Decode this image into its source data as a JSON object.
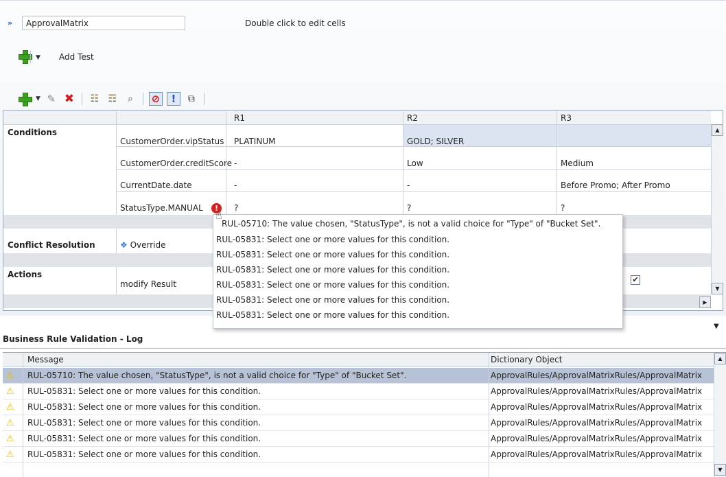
{
  "ruleset": {
    "name_value": "ApprovalMatrix",
    "hint": "Double click to edit cells",
    "add_test_label": "Add Test"
  },
  "grid": {
    "columns": [
      "R1",
      "R2",
      "R3"
    ],
    "sections": {
      "conditions": "Conditions",
      "conflict": "Conflict Resolution",
      "actions": "Actions"
    },
    "conditions": [
      {
        "name": "CustomerOrder.vipStatus",
        "values": [
          "PLATINUM",
          "GOLD; SILVER",
          ""
        ]
      },
      {
        "name": "CustomerOrder.creditScore",
        "values": [
          "-",
          "Low",
          "Medium"
        ]
      },
      {
        "name": "CurrentDate.date",
        "values": [
          "-",
          "-",
          "Before Promo; After Promo"
        ]
      },
      {
        "name": "StatusType.MANUAL",
        "values": [
          "?",
          "?",
          "?"
        ]
      }
    ],
    "conflict_value": "Override",
    "action_name": "modify Result",
    "action_checkbox_checked": true
  },
  "popup": {
    "messages": [
      "RUL-05710: The value chosen, \"StatusType\", is not a valid choice for \"Type\" of \"Bucket Set\".",
      "RUL-05831: Select one or more values for this condition.",
      "RUL-05831: Select one or more values for this condition.",
      "RUL-05831: Select one or more values for this condition.",
      "RUL-05831: Select one or more values for this condition.",
      "RUL-05831: Select one or more values for this condition.",
      "RUL-05831: Select one or more values for this condition."
    ]
  },
  "log": {
    "tab_title": "Business Rule Validation - Log",
    "headers": {
      "message": "Message",
      "object": "Dictionary Object"
    },
    "rows": [
      {
        "message": "RUL-05710: The value chosen, \"StatusType\", is not a valid choice for \"Type\" of \"Bucket Set\".",
        "object": "ApprovalRules/ApprovalMatrixRules/ApprovalMatrix"
      },
      {
        "message": "RUL-05831: Select one or more values for this condition.",
        "object": "ApprovalRules/ApprovalMatrixRules/ApprovalMatrix"
      },
      {
        "message": "RUL-05831: Select one or more values for this condition.",
        "object": "ApprovalRules/ApprovalMatrixRules/ApprovalMatrix"
      },
      {
        "message": "RUL-05831: Select one or more values for this condition.",
        "object": "ApprovalRules/ApprovalMatrixRules/ApprovalMatrix"
      },
      {
        "message": "RUL-05831: Select one or more values for this condition.",
        "object": "ApprovalRules/ApprovalMatrixRules/ApprovalMatrix"
      },
      {
        "message": "RUL-05831: Select one or more values for this condition.",
        "object": "ApprovalRules/ApprovalMatrixRules/ApprovalMatrix"
      }
    ]
  }
}
